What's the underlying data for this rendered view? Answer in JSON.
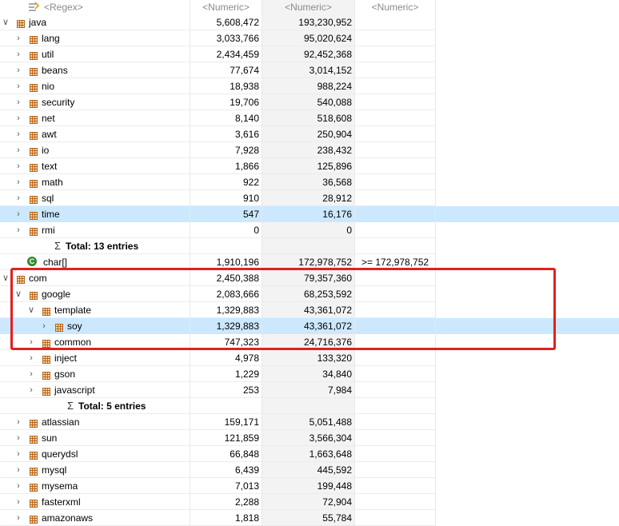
{
  "header": {
    "name_filter": "<Regex>",
    "col1": "<Numeric>",
    "col2": "<Numeric>",
    "col3": "<Numeric>"
  },
  "rows": [
    {
      "depth": 0,
      "type": "pkg",
      "twisty": "open",
      "label": "java",
      "v1": "5,608,472",
      "v2": "193,230,952",
      "v3": ""
    },
    {
      "depth": 1,
      "type": "pkg",
      "twisty": "closed",
      "label": "lang",
      "v1": "3,033,766",
      "v2": "95,020,624",
      "v3": ""
    },
    {
      "depth": 1,
      "type": "pkg",
      "twisty": "closed",
      "label": "util",
      "v1": "2,434,459",
      "v2": "92,452,368",
      "v3": ""
    },
    {
      "depth": 1,
      "type": "pkg",
      "twisty": "closed",
      "label": "beans",
      "v1": "77,674",
      "v2": "3,014,152",
      "v3": ""
    },
    {
      "depth": 1,
      "type": "pkg",
      "twisty": "closed",
      "label": "nio",
      "v1": "18,938",
      "v2": "988,224",
      "v3": ""
    },
    {
      "depth": 1,
      "type": "pkg",
      "twisty": "closed",
      "label": "security",
      "v1": "19,706",
      "v2": "540,088",
      "v3": ""
    },
    {
      "depth": 1,
      "type": "pkg",
      "twisty": "closed",
      "label": "net",
      "v1": "8,140",
      "v2": "518,608",
      "v3": ""
    },
    {
      "depth": 1,
      "type": "pkg",
      "twisty": "closed",
      "label": "awt",
      "v1": "3,616",
      "v2": "250,904",
      "v3": ""
    },
    {
      "depth": 1,
      "type": "pkg",
      "twisty": "closed",
      "label": "io",
      "v1": "7,928",
      "v2": "238,432",
      "v3": ""
    },
    {
      "depth": 1,
      "type": "pkg",
      "twisty": "closed",
      "label": "text",
      "v1": "1,866",
      "v2": "125,896",
      "v3": ""
    },
    {
      "depth": 1,
      "type": "pkg",
      "twisty": "closed",
      "label": "math",
      "v1": "922",
      "v2": "36,568",
      "v3": ""
    },
    {
      "depth": 1,
      "type": "pkg",
      "twisty": "closed",
      "label": "sql",
      "v1": "910",
      "v2": "28,912",
      "v3": ""
    },
    {
      "depth": 1,
      "type": "pkg",
      "twisty": "closed",
      "label": "time",
      "v1": "547",
      "v2": "16,176",
      "v3": "",
      "selected": true
    },
    {
      "depth": 1,
      "type": "pkg",
      "twisty": "closed",
      "label": "rmi",
      "v1": "0",
      "v2": "0",
      "v3": ""
    },
    {
      "depth": 1,
      "type": "total",
      "label": "Total: 13 entries",
      "v1": "",
      "v2": "",
      "v3": ""
    },
    {
      "depth": 0,
      "type": "class",
      "label": "char[]",
      "v1": "1,910,196",
      "v2": "172,978,752",
      "v3": ">= 172,978,752"
    },
    {
      "depth": 0,
      "type": "pkg",
      "twisty": "open",
      "label": "com",
      "v1": "2,450,388",
      "v2": "79,357,360",
      "v3": ""
    },
    {
      "depth": 1,
      "type": "pkg",
      "twisty": "open",
      "label": "google",
      "v1": "2,083,666",
      "v2": "68,253,592",
      "v3": ""
    },
    {
      "depth": 2,
      "type": "pkg",
      "twisty": "open",
      "label": "template",
      "v1": "1,329,883",
      "v2": "43,361,072",
      "v3": ""
    },
    {
      "depth": 3,
      "type": "pkg",
      "twisty": "closed",
      "label": "soy",
      "v1": "1,329,883",
      "v2": "43,361,072",
      "v3": "",
      "selected": true
    },
    {
      "depth": 2,
      "type": "pkg",
      "twisty": "closed",
      "label": "common",
      "v1": "747,323",
      "v2": "24,716,376",
      "v3": ""
    },
    {
      "depth": 2,
      "type": "pkg",
      "twisty": "closed",
      "label": "inject",
      "v1": "4,978",
      "v2": "133,320",
      "v3": ""
    },
    {
      "depth": 2,
      "type": "pkg",
      "twisty": "closed",
      "label": "gson",
      "v1": "1,229",
      "v2": "34,840",
      "v3": ""
    },
    {
      "depth": 2,
      "type": "pkg",
      "twisty": "closed",
      "label": "javascript",
      "v1": "253",
      "v2": "7,984",
      "v3": ""
    },
    {
      "depth": 2,
      "type": "total",
      "label": "Total: 5 entries",
      "v1": "",
      "v2": "",
      "v3": ""
    },
    {
      "depth": 1,
      "type": "pkg",
      "twisty": "closed",
      "label": "atlassian",
      "v1": "159,171",
      "v2": "5,051,488",
      "v3": ""
    },
    {
      "depth": 1,
      "type": "pkg",
      "twisty": "closed",
      "label": "sun",
      "v1": "121,859",
      "v2": "3,566,304",
      "v3": ""
    },
    {
      "depth": 1,
      "type": "pkg",
      "twisty": "closed",
      "label": "querydsl",
      "v1": "66,848",
      "v2": "1,663,648",
      "v3": ""
    },
    {
      "depth": 1,
      "type": "pkg",
      "twisty": "closed",
      "label": "mysql",
      "v1": "6,439",
      "v2": "445,592",
      "v3": ""
    },
    {
      "depth": 1,
      "type": "pkg",
      "twisty": "closed",
      "label": "mysema",
      "v1": "7,013",
      "v2": "199,448",
      "v3": ""
    },
    {
      "depth": 1,
      "type": "pkg",
      "twisty": "closed",
      "label": "fasterxml",
      "v1": "2,288",
      "v2": "72,904",
      "v3": ""
    },
    {
      "depth": 1,
      "type": "pkg",
      "twisty": "closed",
      "label": "amazonaws",
      "v1": "1,818",
      "v2": "55,784",
      "v3": ""
    }
  ],
  "colors": {
    "selection": "#cce8ff",
    "highlight_box": "#e02020",
    "package_icon": "#b5651d",
    "class_icon": "#2e8b2e"
  }
}
